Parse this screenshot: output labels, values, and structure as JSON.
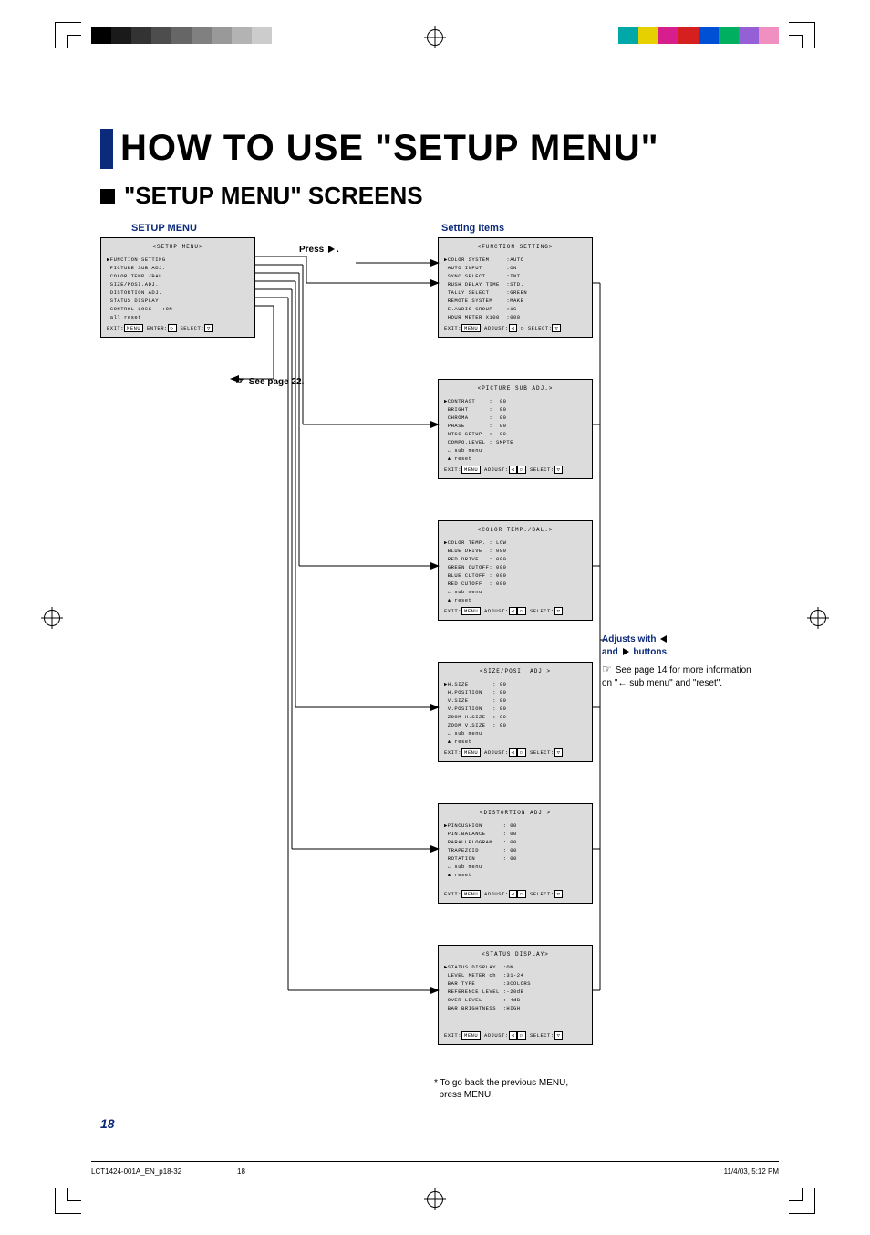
{
  "print_marks": {
    "gray_swatches": [
      "#000000",
      "#1a1a1a",
      "#333333",
      "#4d4d4d",
      "#666666",
      "#808080",
      "#999999",
      "#b3b3b3",
      "#cccccc",
      "#ffffff"
    ],
    "color_swatches": [
      "#00a8a8",
      "#e6d000",
      "#d61f8c",
      "#d62020",
      "#0050d6",
      "#00b060",
      "#9560d6",
      "#f090c0"
    ]
  },
  "title": "HOW TO USE \"SETUP MENU\"",
  "subtitle": "\"SETUP MENU\" SCREENS",
  "labels": {
    "setup_menu": "SETUP MENU",
    "setting_items": "Setting Items",
    "press": "Press",
    "press_suffix": ".",
    "see_page_22": "See page 22.",
    "hand_glyph": "☞"
  },
  "connector_arrow": {
    "from_main_to_column": true
  },
  "main_osd": {
    "title": "<SETUP MENU>",
    "lines": [
      "▶FUNCTION SETTING",
      " PICTURE SUB ADJ.",
      " COLOR TEMP./BAL.",
      " SIZE/POSI.ADJ.",
      " DISTORTION ADJ.",
      " STATUS DISPLAY",
      " CONTROL LOCK   :ON",
      " all reset"
    ],
    "footer_parts": [
      "EXIT:",
      "MENU",
      " ENTER:",
      "▷",
      " SELECT:",
      "▽"
    ]
  },
  "screens": [
    {
      "title": "<FUNCTION SETTING>",
      "lines": [
        "▶COLOR SYSTEM     :AUTO",
        " AUTO INPUT       :ON",
        " SYNC SELECT      :INT.",
        " RUSH DELAY TIME  :STD.",
        " TALLY SELECT     :GREEN",
        " REMOTE SYSTEM    :MAKE",
        " E.AUDIO GROUP    :1G",
        " HOUR METER X100  :000"
      ],
      "footer_parts": [
        "EXIT:",
        "MENU",
        " ADJUST:",
        "◁",
        " ▷ SELECT:",
        "▽"
      ]
    },
    {
      "title": "<PICTURE SUB ADJ.>",
      "lines": [
        "▶CONTRAST    :  00",
        " BRIGHT      :  00",
        " CHROMA      :  00",
        " PHASE       :  00",
        " NTSC SETUP  :  00",
        " COMPO.LEVEL : SMPTE",
        " ← sub menu",
        " ▲ reset"
      ],
      "footer_parts": [
        "EXIT:",
        "MENU",
        " ADJUST:",
        "◁",
        "▷",
        " SELECT:",
        "▽"
      ]
    },
    {
      "title": "<COLOR TEMP./BAL.>",
      "lines": [
        "▶COLOR TEMP. : LOW",
        " BLUE DRIVE  : 000",
        " RED DRIVE   : 000",
        " GREEN CUTOFF: 000",
        " BLUE CUTOFF : 000",
        " RED CUTOFF  : 000",
        " ← sub menu",
        " ▲ reset"
      ],
      "footer_parts": [
        "EXIT:",
        "MENU",
        " ADJUST:",
        "◁",
        "▷",
        " SELECT:",
        "▽"
      ]
    },
    {
      "title": "<SIZE/POSI. ADJ.>",
      "lines": [
        "▶H.SIZE       : 00",
        " H.POSITION   : 00",
        " V.SIZE       : 00",
        " V.POSITION   : 00",
        " ZOOM H.SIZE  : 00",
        " ZOOM V.SIZE  : 00",
        " ← sub menu",
        " ▲ reset"
      ],
      "footer_parts": [
        "EXIT:",
        "MENU",
        " ADJUST:",
        "◁",
        "▷",
        " SELECT:",
        "▽"
      ]
    },
    {
      "title": "<DISTORTION ADJ.>",
      "lines": [
        "▶PINCUSHION      : 00",
        " PIN.BALANCE     : 00",
        " PARALLELOGRAM   : 00",
        " TRAPEZOID       : 00",
        " ROTATION        : 00",
        " ← sub menu",
        " ▲ reset"
      ],
      "footer_parts": [
        "EXIT:",
        "MENU",
        " ADJUST:",
        "◁",
        "▷",
        " SELECT:",
        "▽"
      ]
    },
    {
      "title": "<STATUS DISPLAY>",
      "lines": [
        "▶STATUS DISPLAY  :ON",
        " LEVEL METER ch  :31-24",
        " BAR TYPE        :3COLORS",
        " REFERENCE LEVEL :-20dB",
        " OVER LEVEL      :-4dB",
        " BAR BRIGHTNESS  :HIGH"
      ],
      "footer_parts": [
        "EXIT:",
        "MENU",
        " ADJUST:",
        "◁",
        "▷",
        " SELECT:",
        "▽"
      ]
    }
  ],
  "right_note": {
    "head1": "Adjusts with",
    "head2": "and",
    "head3": "buttons.",
    "body": "See page 14 for more information on \"← sub menu\" and \"reset\"."
  },
  "footnote": "* To go back the previous MENU,\n  press MENU.",
  "page_number": "18",
  "footer": {
    "left": "LCT1424-001A_EN_p18-32",
    "center": "18",
    "right": "11/4/03, 5:12 PM"
  }
}
